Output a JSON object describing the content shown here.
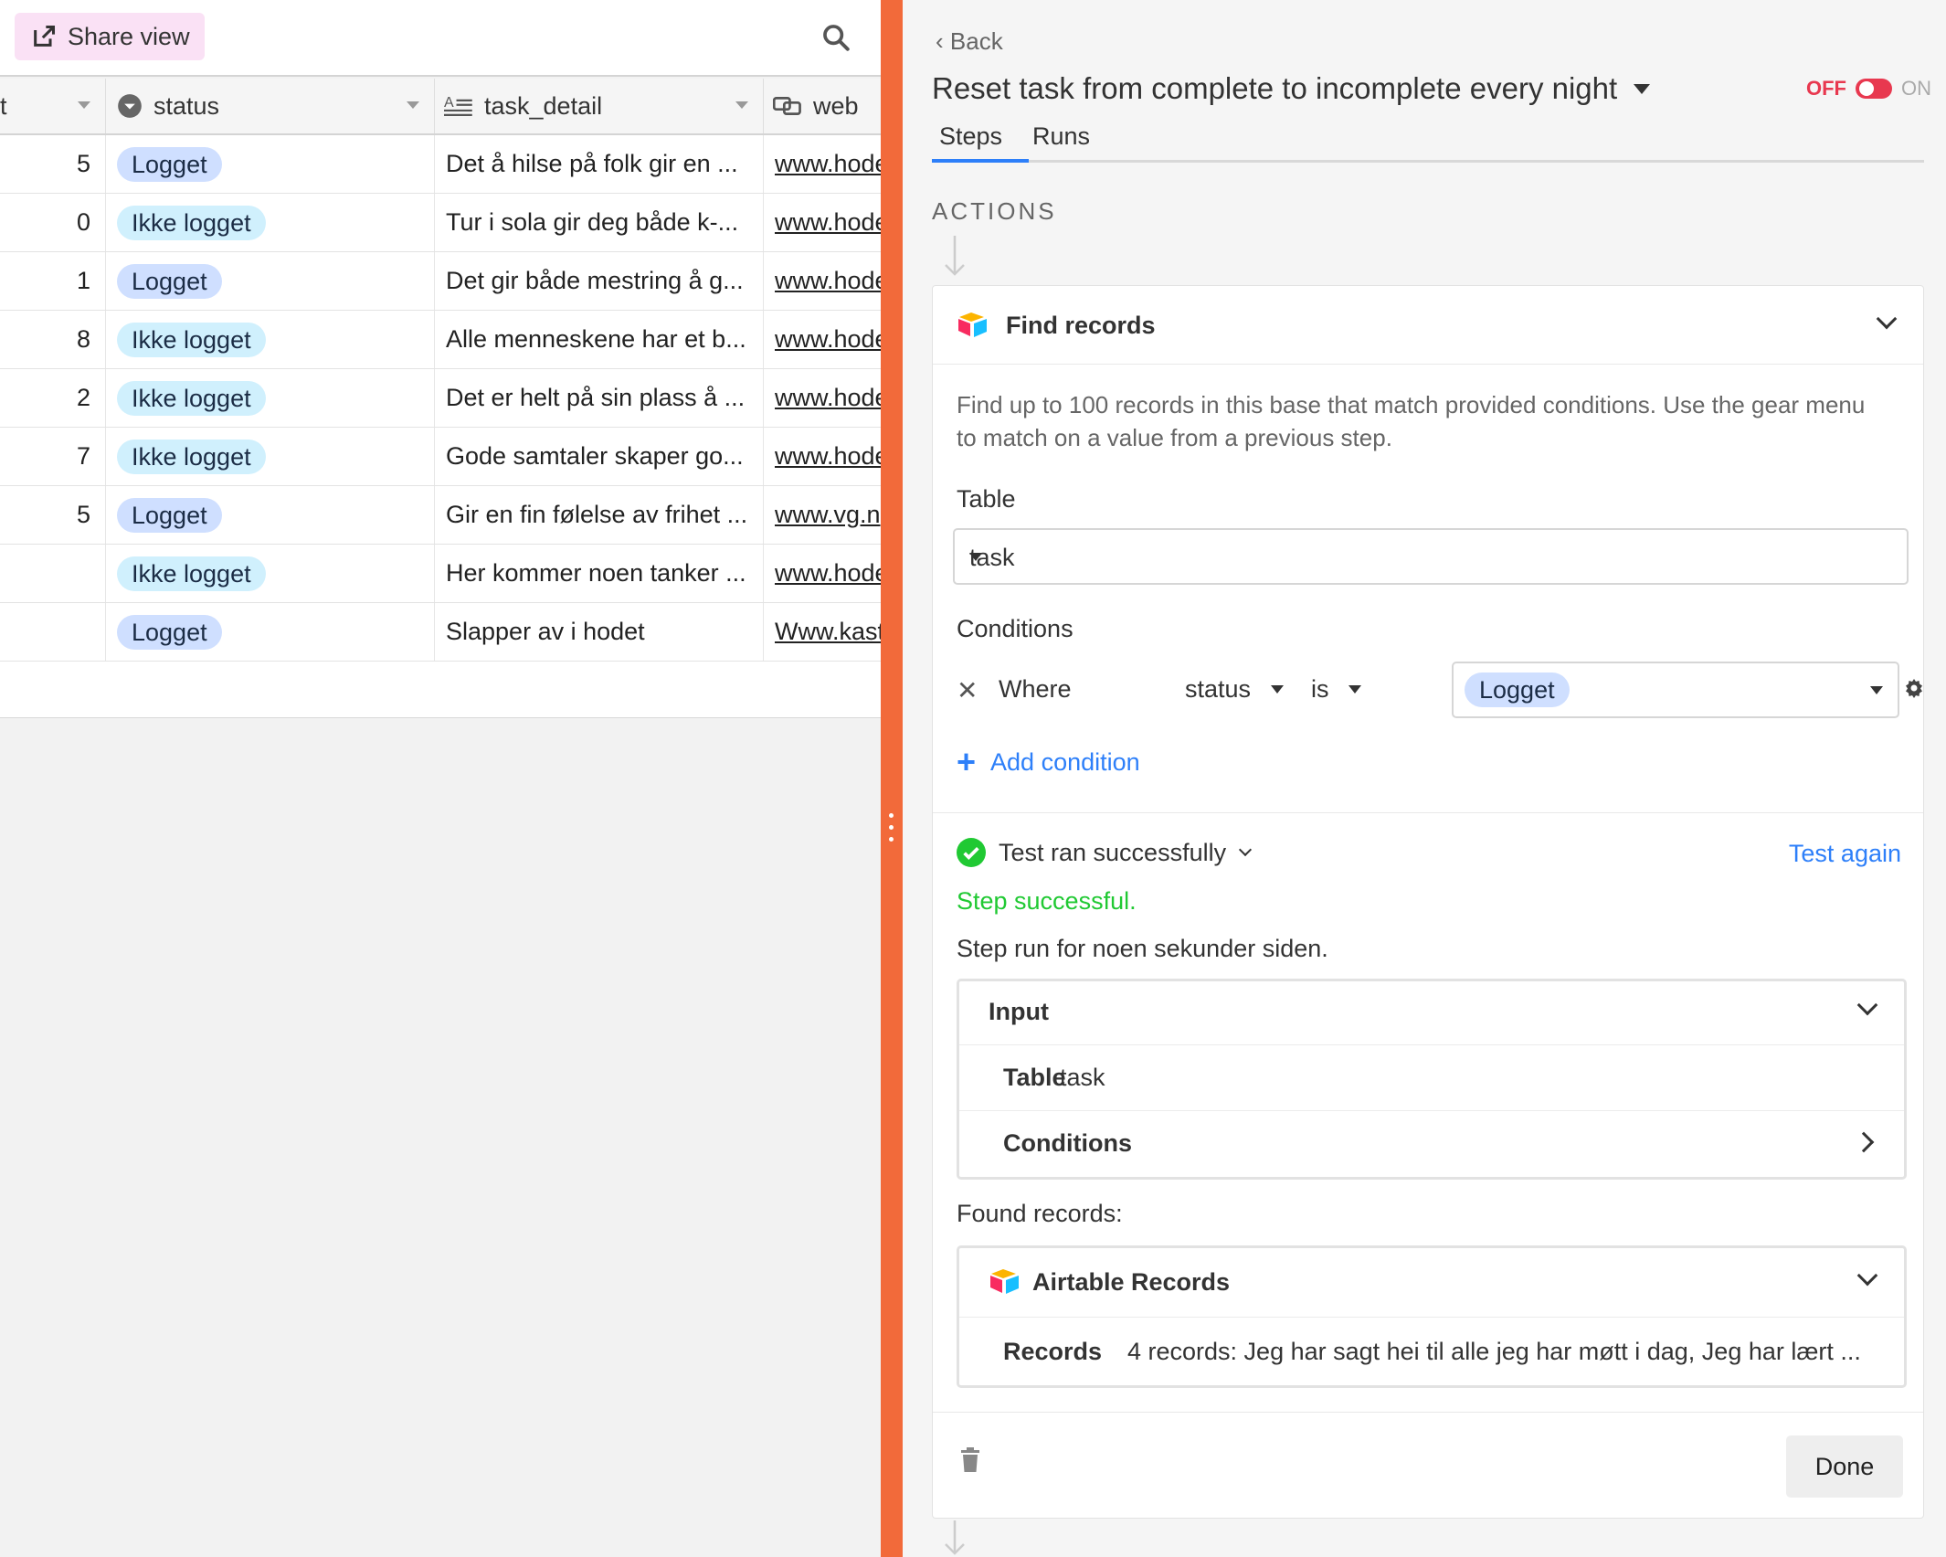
{
  "toolbar": {
    "share_label": "Share view"
  },
  "grid": {
    "columns": [
      {
        "name": "t"
      },
      {
        "name": "status"
      },
      {
        "name": "task_detail"
      },
      {
        "name": "web"
      }
    ],
    "rows": [
      {
        "num": "5",
        "status": "Logget",
        "detail": "Det å hilse på folk gir en ...",
        "web": "www.hode"
      },
      {
        "num": "0",
        "status": "Ikke logget",
        "detail": "Tur i sola gir deg både k-...",
        "web": "www.hode"
      },
      {
        "num": "1",
        "status": "Logget",
        "detail": "Det gir både mestring å g...",
        "web": "www.hode"
      },
      {
        "num": "8",
        "status": "Ikke logget",
        "detail": "Alle menneskene har et b...",
        "web": "www.hode"
      },
      {
        "num": "2",
        "status": "Ikke logget",
        "detail": "Det er helt på sin plass å ...",
        "web": "www.hode"
      },
      {
        "num": "7",
        "status": "Ikke logget",
        "detail": "Gode samtaler skaper go...",
        "web": "www.hode"
      },
      {
        "num": "5",
        "status": "Logget",
        "detail": "Gir en fin følelse av frihet ...",
        "web": "www.vg.n"
      },
      {
        "num": "",
        "status": "Ikke logget",
        "detail": "Her kommer noen tanker ...",
        "web": "www.hode"
      },
      {
        "num": "",
        "status": "Logget",
        "detail": "Slapper av i hodet",
        "web": "Www.kast"
      }
    ]
  },
  "automation": {
    "back": "Back",
    "title": "Reset task from complete to incomplete every night",
    "toggle_off": "OFF",
    "toggle_on": "ON",
    "tabs": {
      "steps": "Steps",
      "runs": "Runs"
    },
    "section": "ACTIONS",
    "step": {
      "title": "Find records",
      "description": "Find up to 100 records in this base that match provided conditions. Use the gear menu to match on a value from a previous step.",
      "table_label": "Table",
      "table_value": "task",
      "conditions_label": "Conditions",
      "condition": {
        "where": "Where",
        "field": "status",
        "operator": "is",
        "value": "Logget"
      },
      "add_condition": "Add condition",
      "test": {
        "status": "Test ran successfully",
        "test_again": "Test again",
        "step_success": "Step successful.",
        "step_run": "Step run for noen sekunder siden.",
        "input": {
          "header": "Input",
          "table_key": "Table",
          "table_val": "task",
          "conditions": "Conditions"
        },
        "found_label": "Found records:",
        "records": {
          "header": "Airtable Records",
          "key": "Records",
          "val": "4 records: Jeg har sagt hei til alle jeg har møtt i dag, Jeg har lært ..."
        }
      },
      "done": "Done"
    }
  },
  "colors": {
    "accent_blue": "#2d7ff9",
    "success_green": "#20c933",
    "divider_orange": "#f26a3a",
    "toggle_red": "#e8384f"
  }
}
